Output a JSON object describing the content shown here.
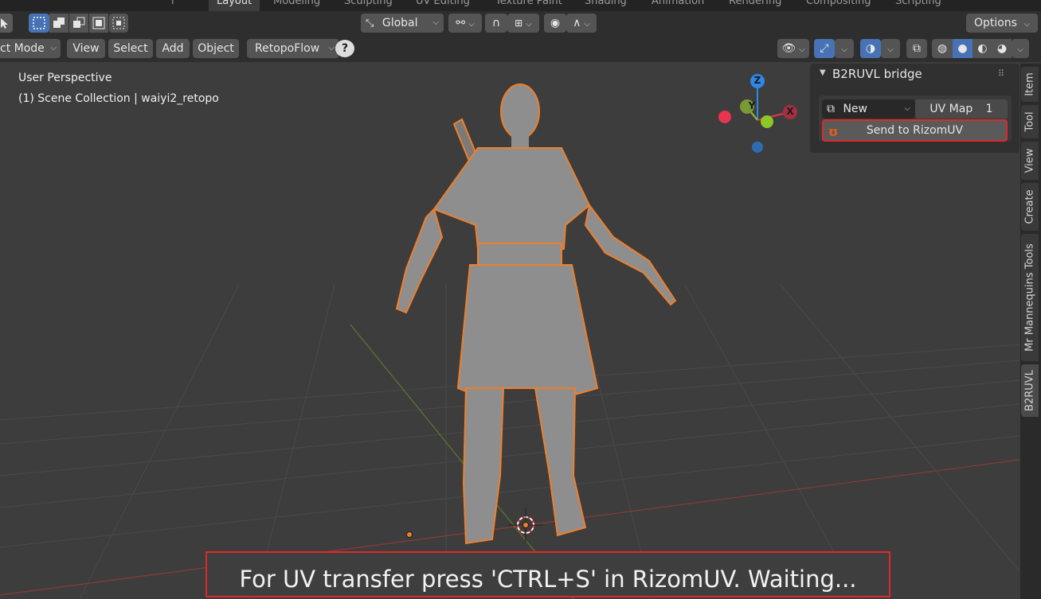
{
  "workspace_tabs": [
    {
      "label": "Layout",
      "active": true
    },
    {
      "label": "Modeling",
      "active": false
    },
    {
      "label": "Sculpting",
      "active": false
    },
    {
      "label": "UV Editing",
      "active": false
    },
    {
      "label": "Texture Paint",
      "active": false
    },
    {
      "label": "Shading",
      "active": false
    },
    {
      "label": "Animation",
      "active": false
    },
    {
      "label": "Rendering",
      "active": false
    },
    {
      "label": "Compositing",
      "active": false
    },
    {
      "label": "Scripting",
      "active": false
    }
  ],
  "header": {
    "orientation_label": "Global",
    "options_label": "Options"
  },
  "menu": {
    "mode_label": "ct Mode",
    "view": "View",
    "select": "Select",
    "add": "Add",
    "object": "Object",
    "retopoflow": "RetopoFlow",
    "help_glyph": "?"
  },
  "viewport": {
    "perspective_label": "User Perspective",
    "collection_label": "(1) Scene Collection | waiyi2_retopo",
    "gizmo": {
      "z": "Z",
      "y": "Y",
      "x": "X"
    }
  },
  "panel": {
    "title": "B2RUVL bridge",
    "new_label": "New",
    "uvmap_label": "UV Map",
    "uvmap_count": "1",
    "send_label": "Send to RizomUV"
  },
  "side_tabs": [
    "Item",
    "Tool",
    "View",
    "Create",
    "Mr Mannequins Tools",
    "B2RUVL"
  ],
  "status_message": "For UV transfer press 'CTRL+S' in RizomUV. Waiting...",
  "colors": {
    "accent": "#4772b3",
    "highlight_box": "#e02828",
    "selection_outline": "#f07f2a",
    "axis_x": "#e8344e",
    "axis_y": "#8cc926",
    "axis_z": "#2f86e6"
  }
}
